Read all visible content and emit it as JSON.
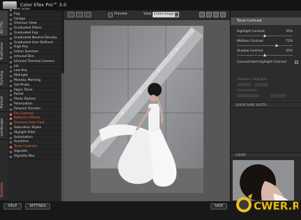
{
  "app": {
    "title": "Color Efex Pro™ 3.0"
  },
  "toolbar": {
    "preview_label": "Preview",
    "view_label": "View",
    "view_value": "Entire Image"
  },
  "categories": [
    {
      "label": "All (75)",
      "id": "all"
    },
    {
      "label": "Traditional",
      "id": "traditional"
    },
    {
      "label": "Stylizing",
      "id": "stylizing"
    },
    {
      "label": "Portrait",
      "id": "portrait"
    },
    {
      "label": "Landscape",
      "id": "landscape"
    },
    {
      "label": "Favorites",
      "id": "favorites"
    }
  ],
  "filters": [
    "Film Grain",
    "Fog",
    "Foliage",
    "Glamour Glow",
    "Graduated Filters",
    "Graduated Fog",
    "Graduated Neutral Density",
    "Graduated User Defined",
    "High Key",
    "Indian Summer",
    "Infrared Film",
    "Infrared Thermal Camera",
    "Ink",
    "Low Key",
    "Midnight",
    "Monday Morning",
    "Old Photo",
    "Paper Toner",
    "Pastel",
    "Photo Stylizer",
    "Polarization",
    "Polaroid Transfer",
    "Pro Contrast",
    "Reflector Effects",
    "Remove Color Cast",
    "Saturation Styles",
    "Skylight Filter",
    "Solarization",
    "Sunshine",
    "Tonal Contrast",
    "Vignette",
    "Vignette Blur"
  ],
  "selected_filter": "Tonal Contrast",
  "right_panel": {
    "title": "Tonal Contrast",
    "sliders": [
      {
        "label": "Highlight Contrast",
        "value": "50%",
        "level": 0.5
      },
      {
        "label": "Midtone Contrast",
        "value": "72%",
        "level": 0.72
      },
      {
        "label": "Shadow Contrast",
        "value": "50%",
        "level": 0.5
      }
    ],
    "checkbox_label": "Concentrated Highlight Contrast",
    "faded_labels": [
      "Shadows / Highlights",
      "Control Points"
    ],
    "section_quick": "QUICK SAVE SLOTS",
    "section_loupe": "LOUPE"
  },
  "bottom": {
    "help": "HELP",
    "settings": "SETTINGS",
    "save": "SAVE"
  },
  "watermark": {
    "text": "CWER.RU"
  }
}
